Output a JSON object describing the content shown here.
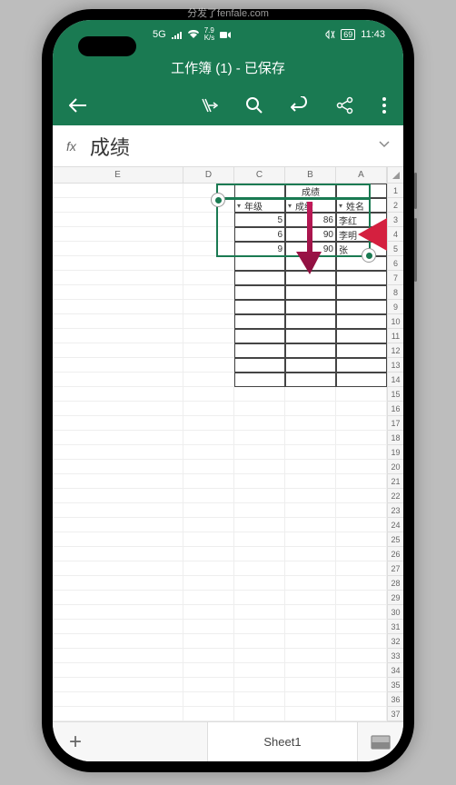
{
  "status": {
    "signal": "5G",
    "speed": "7.9",
    "speed_unit": "K/s",
    "battery": "69",
    "time": "11:43"
  },
  "title": "工作簿 (1) - 已保存",
  "formula": {
    "label": "fx",
    "value": "成绩"
  },
  "columns": [
    "E",
    "D",
    "C",
    "B",
    "A"
  ],
  "row_numbers": [
    "1",
    "2",
    "3",
    "4",
    "5",
    "6",
    "7",
    "8",
    "9",
    "10",
    "11",
    "12",
    "13",
    "14",
    "15",
    "16",
    "17",
    "18",
    "19",
    "20",
    "21",
    "22",
    "23",
    "24",
    "25",
    "26",
    "27",
    "28",
    "29",
    "30",
    "31",
    "32",
    "33",
    "34",
    "35",
    "36",
    "37"
  ],
  "table": {
    "header_merged": "成绩",
    "filters": [
      "年级",
      "成绩",
      "姓名"
    ],
    "rows": [
      {
        "c": "5",
        "b": "86",
        "a": "李红"
      },
      {
        "c": "6",
        "b": "90",
        "a": "李明"
      },
      {
        "c": "9",
        "b": "90",
        "a": "张"
      }
    ]
  },
  "sheet": {
    "name": "Sheet1",
    "add": "+"
  },
  "watermark": "分发了fenfale.com"
}
